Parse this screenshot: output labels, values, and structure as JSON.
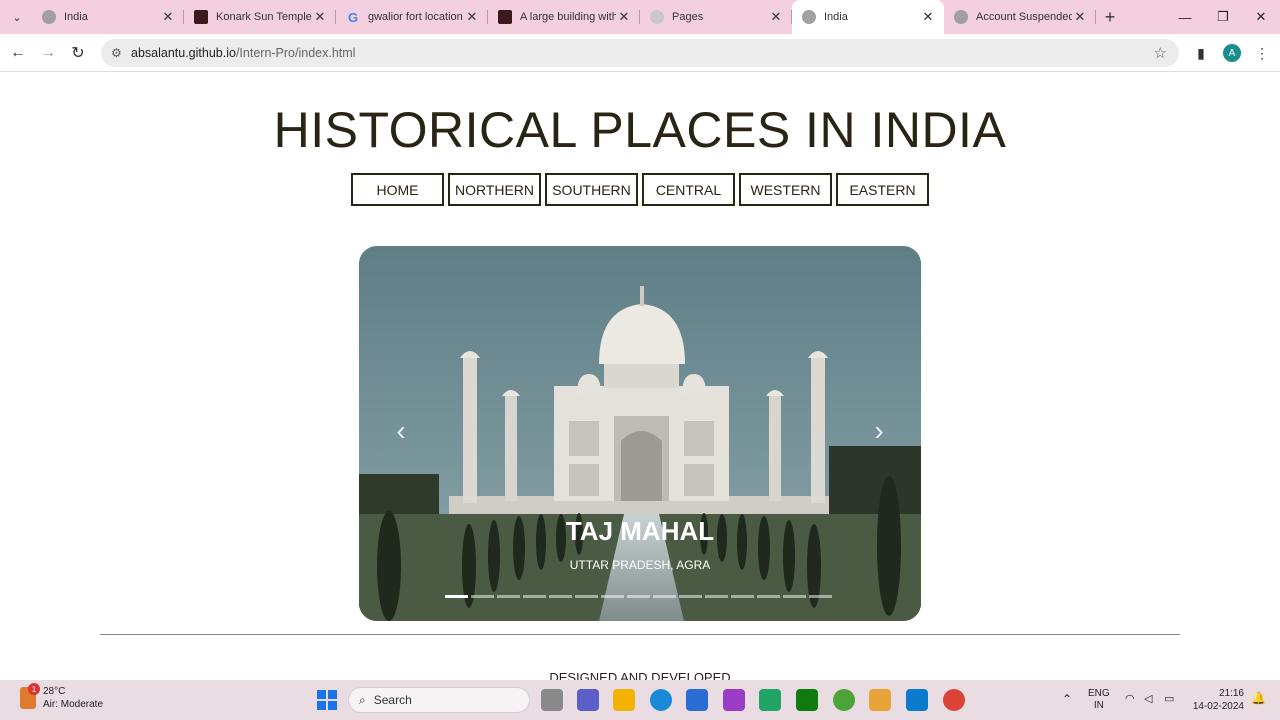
{
  "browser": {
    "tabs": [
      {
        "label": "India",
        "icon": "globe-icon",
        "active": false
      },
      {
        "label": "Konark Sun Temple in",
        "icon": "site-icon",
        "active": false
      },
      {
        "label": "gwalior fort location",
        "icon": "google-icon",
        "active": false
      },
      {
        "label": "A large building with",
        "icon": "site-icon",
        "active": false
      },
      {
        "label": "Pages",
        "icon": "github-icon",
        "active": false
      },
      {
        "label": "India",
        "icon": "globe-icon",
        "active": true
      },
      {
        "label": "Account Suspended",
        "icon": "globe-icon",
        "active": false
      }
    ],
    "url_host": "absalantu.github.io",
    "url_path": "/Intern-Pro/index.html",
    "profile_initial": "A"
  },
  "page": {
    "title": "HISTORICAL PLACES IN INDIA",
    "nav": [
      "HOME",
      "NORTHERN",
      "SOUTHERN",
      "CENTRAL",
      "WESTERN",
      "EASTERN"
    ],
    "carousel": {
      "caption_title": "TAJ MAHAL",
      "caption_subtitle": "UTTAR PRADESH, AGRA",
      "prev_icon": "‹",
      "next_icon": "›",
      "indicator_count": 15,
      "active_index": 0
    },
    "footer_text": "DESIGNED AND DEVELOPED"
  },
  "taskbar": {
    "weather_temp": "28°C",
    "weather_desc": "Air: Moderate",
    "weather_badge": "1",
    "search_placeholder": "Search",
    "lang_top": "ENG",
    "lang_bottom": "IN",
    "time": "21:16",
    "date": "14-02-2024"
  }
}
